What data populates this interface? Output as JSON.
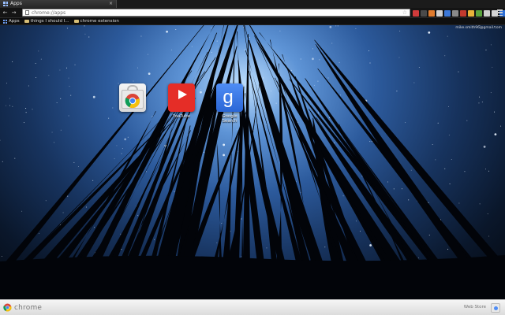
{
  "window": {
    "tab_title": "Apps",
    "tab_close": "×"
  },
  "toolbar": {
    "back": "←",
    "forward": "→",
    "reload": "↻",
    "url": "chrome://apps",
    "star": "☆",
    "extensions": [
      {
        "name": "ext-1",
        "color": "#d13b3b"
      },
      {
        "name": "ext-2",
        "color": "#4a4a4a"
      },
      {
        "name": "ext-3",
        "color": "#e07b2d"
      },
      {
        "name": "ext-4",
        "color": "#d0d0d0"
      },
      {
        "name": "ext-5",
        "color": "#3c78d8"
      },
      {
        "name": "ext-6",
        "color": "#8a8a8a"
      },
      {
        "name": "ext-7",
        "color": "#c33a2e"
      },
      {
        "name": "ext-8",
        "color": "#e8b33a"
      },
      {
        "name": "ext-9",
        "color": "#5aa33d"
      },
      {
        "name": "ext-10",
        "color": "#cfcfcf"
      },
      {
        "name": "ext-11",
        "color": "#d4d4d4"
      },
      {
        "name": "ext-12",
        "color": "#2d6fd6"
      },
      {
        "name": "ext-13",
        "color": "#9c4ad1"
      },
      {
        "name": "ext-14",
        "color": "#d62d2d"
      }
    ]
  },
  "bookmarks": {
    "apps_label": "Apps",
    "items": [
      {
        "label": "things I should I..."
      },
      {
        "label": "chrome extension"
      }
    ]
  },
  "user": {
    "email": "mike.smith96@gmail.com"
  },
  "apps": [
    {
      "name": "Web Store",
      "label": ""
    },
    {
      "name": "YouTube",
      "label": "YouTube"
    },
    {
      "name": "Google Search",
      "label": "Google Search"
    }
  ],
  "search_tile_letter": "g",
  "bottombar": {
    "brand": "chrome",
    "store_link": "Web Store"
  }
}
